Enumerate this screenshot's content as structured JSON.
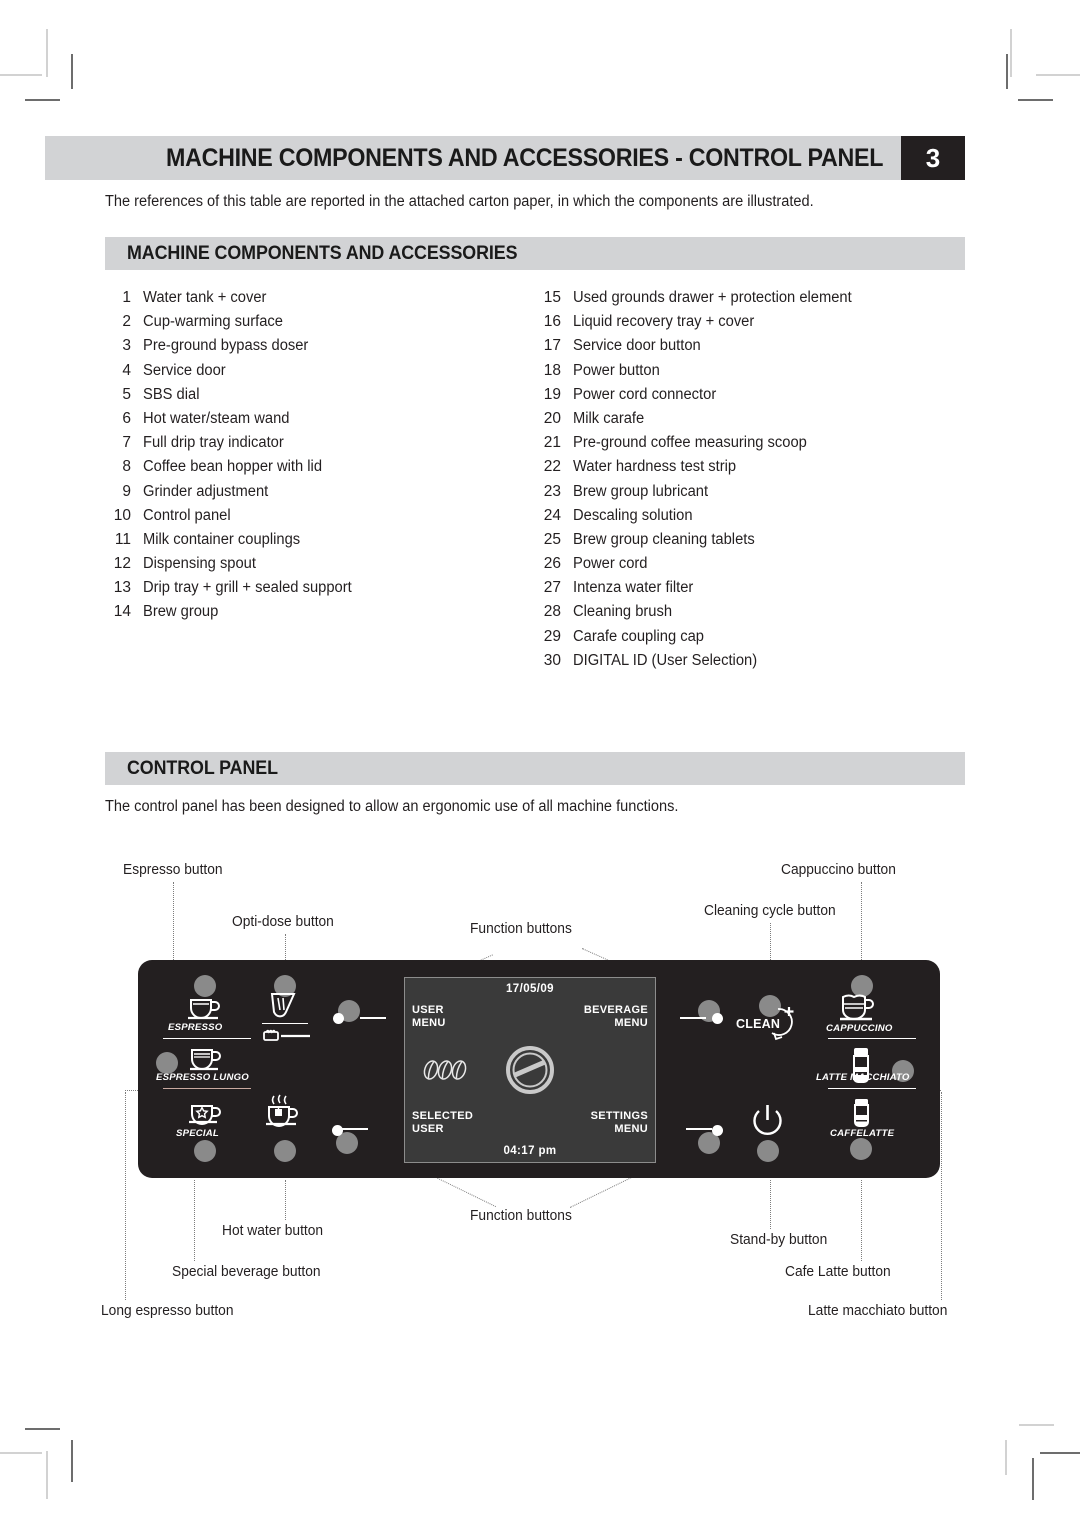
{
  "header": {
    "chapter_title": "MACHINE COMPONENTS AND ACCESSORIES - CONTROL PANEL",
    "chapter_number": "3"
  },
  "intro_text": "The references of this table are reported in the attached carton paper, in which the components are illustrated.",
  "sections": {
    "components": {
      "heading": "MACHINE COMPONENTS AND ACCESSORIES"
    },
    "control_panel": {
      "heading": "CONTROL PANEL",
      "paragraph": "The control panel has been designed to allow an ergonomic use of all machine functions."
    }
  },
  "components_list_left": [
    {
      "num": "1",
      "label": "Water tank + cover"
    },
    {
      "num": "2",
      "label": "Cup-warming surface"
    },
    {
      "num": "3",
      "label": "Pre-ground bypass doser"
    },
    {
      "num": "4",
      "label": "Service door"
    },
    {
      "num": "5",
      "label": "SBS dial"
    },
    {
      "num": "6",
      "label": "Hot water/steam wand"
    },
    {
      "num": "7",
      "label": "Full drip tray indicator"
    },
    {
      "num": "8",
      "label": "Coffee bean hopper with lid"
    },
    {
      "num": "9",
      "label": "Grinder adjustment"
    },
    {
      "num": "10",
      "label": "Control panel"
    },
    {
      "num": "11",
      "label": "Milk container couplings"
    },
    {
      "num": "12",
      "label": "Dispensing spout"
    },
    {
      "num": "13",
      "label": "Drip tray + grill + sealed support"
    },
    {
      "num": "14",
      "label": "Brew group"
    }
  ],
  "components_list_right": [
    {
      "num": "15",
      "label": "Used grounds drawer + protection element"
    },
    {
      "num": "16",
      "label": "Liquid recovery tray + cover"
    },
    {
      "num": "17",
      "label": "Service door button"
    },
    {
      "num": "18",
      "label": "Power button"
    },
    {
      "num": "19",
      "label": "Power cord connector"
    },
    {
      "num": "20",
      "label": "Milk carafe"
    },
    {
      "num": "21",
      "label": "Pre-ground coffee measuring scoop"
    },
    {
      "num": "22",
      "label": "Water hardness test strip"
    },
    {
      "num": "23",
      "label": "Brew group lubricant"
    },
    {
      "num": "24",
      "label": "Descaling solution"
    },
    {
      "num": "25",
      "label": "Brew group cleaning tablets"
    },
    {
      "num": "26",
      "label": "Power cord"
    },
    {
      "num": "27",
      "label": "Intenza water filter"
    },
    {
      "num": "28",
      "label": "Cleaning brush"
    },
    {
      "num": "29",
      "label": "Carafe coupling cap"
    },
    {
      "num": "30",
      "label": "DIGITAL ID (User Selection)"
    }
  ],
  "control_panel_diagram": {
    "panel_labels": {
      "espresso": "ESPRESSO",
      "espresso_lungo": "ESPRESSO LUNGO",
      "special": "SPECIAL",
      "clean": "CLEAN",
      "cappuccino": "CAPPUCCINO",
      "latte_macchiato": "LATTE MACCHIATO",
      "caffelatte": "CAFFELATTE"
    },
    "display": {
      "date": "17/05/09",
      "time": "04:17 pm",
      "top_left": "USER\nMENU",
      "top_left_line1": "USER",
      "top_left_line2": "MENU",
      "top_right_line1": "BEVERAGE",
      "top_right_line2": "MENU",
      "bottom_left_line1": "SELECTED",
      "bottom_left_line2": "USER",
      "bottom_right_line1": "SETTINGS",
      "bottom_right_line2": "MENU"
    },
    "callouts": {
      "espresso_button": "Espresso button",
      "opti_dose_button": "Opti-dose button",
      "function_buttons_top": "Function buttons",
      "cleaning_cycle_button": "Cleaning cycle button",
      "cappuccino_button": "Cappuccino button",
      "hot_water_button": "Hot water button",
      "function_buttons_bottom": "Function buttons",
      "stand_by_button": "Stand-by button",
      "special_beverage_button": "Special beverage button",
      "cafe_latte_button": "Cafe Latte button",
      "long_espresso_button": "Long espresso button",
      "latte_macchiato_button": "Latte macchiato button"
    }
  },
  "colors": {
    "band_grey": "#d2d3d5",
    "panel_black": "#231f20",
    "button_grey": "#8a8a8a",
    "display_grey": "#3a3a3a"
  }
}
